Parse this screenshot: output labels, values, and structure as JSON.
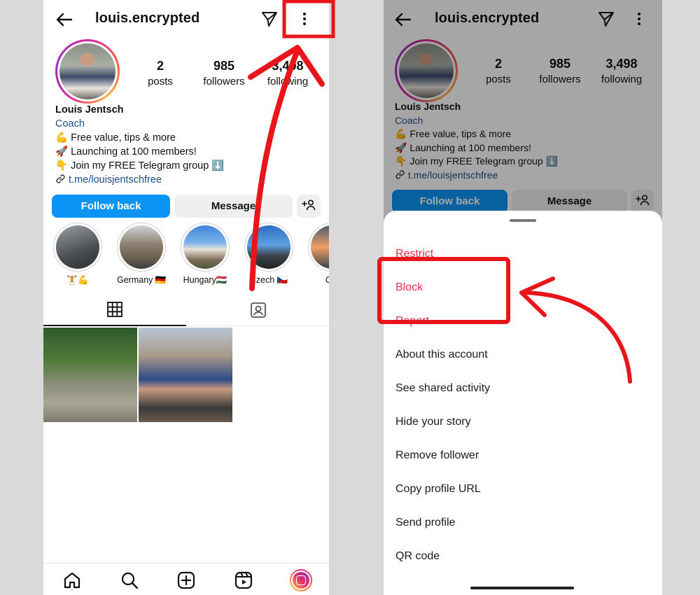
{
  "profile": {
    "username": "louis.encrypted",
    "posts_count": "2",
    "posts_label": "posts",
    "followers_count": "985",
    "followers_label": "followers",
    "following_count": "3,498",
    "following_label": "following",
    "display_name": "Louis Jentsch",
    "category": "Coach",
    "bio_lines": [
      "💪 Free value, tips & more",
      "🚀 Launching at 100 members!",
      "👇 Join my FREE Telegram group ⬇️"
    ],
    "link": "t.me/louisjentschfree"
  },
  "actions": {
    "follow_back": "Follow back",
    "message": "Message",
    "add_person_icon": "add-person-icon"
  },
  "highlights": [
    {
      "label": "🏋️💪"
    },
    {
      "label": "Germany 🇩🇪"
    },
    {
      "label": "Hungary🇭🇺"
    },
    {
      "label": "Czech 🇨🇿"
    },
    {
      "label": "Cro"
    }
  ],
  "sheet_menu": {
    "items": [
      {
        "label": "Restrict",
        "danger": true
      },
      {
        "label": "Block",
        "danger": true
      },
      {
        "label": "Report",
        "danger": true
      },
      {
        "label": "About this account",
        "danger": false
      },
      {
        "label": "See shared activity",
        "danger": false
      },
      {
        "label": "Hide your story",
        "danger": false
      },
      {
        "label": "Remove follower",
        "danger": false
      },
      {
        "label": "Copy profile URL",
        "danger": false
      },
      {
        "label": "Send profile",
        "danger": false
      },
      {
        "label": "QR code",
        "danger": false
      }
    ]
  },
  "colors": {
    "accent_blue": "#0a95f6",
    "link_blue": "#1c4f8a",
    "danger_red": "#e3304a",
    "annotation_red": "#e8151b"
  }
}
